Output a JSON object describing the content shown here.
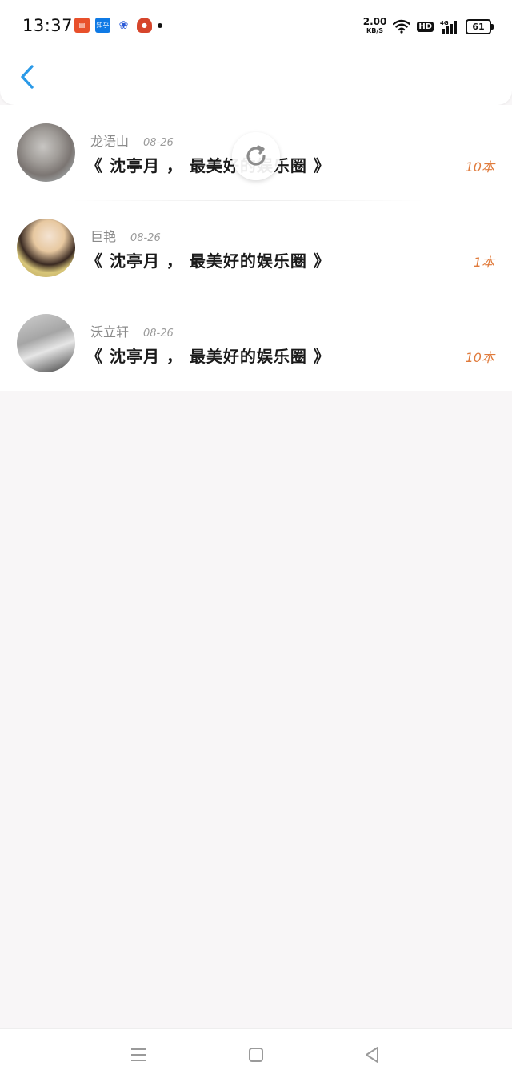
{
  "status_bar": {
    "time": "13:37",
    "net_speed": "2.00",
    "net_unit": "KB/S",
    "hd": "HD",
    "signal": "4G",
    "battery": "61",
    "notification_icons": [
      "ebook-app-icon",
      "zhihu-app-icon",
      "baidu-app-icon",
      "game-app-icon"
    ],
    "notification_labels": {
      "zhihu": "知乎"
    }
  },
  "header": {
    "back_icon": "chevron-left-icon",
    "accent_color": "#2b9ae8"
  },
  "list": [
    {
      "author": "龙语山",
      "date": "08-26",
      "title": "《 沈亭月 ， 最美好的娱乐圈 》",
      "count": "10本"
    },
    {
      "author": "巨艳",
      "date": "08-26",
      "title": "《 沈亭月 ， 最美好的娱乐圈 》",
      "count": "1本"
    },
    {
      "author": "沃立轩",
      "date": "08-26",
      "title": "《 沈亭月 ， 最美好的娱乐圈 》",
      "count": "10本"
    }
  ],
  "colors": {
    "count_color": "#e07b3c",
    "page_background": "#f8f6f7"
  },
  "nav_bar": {
    "icons": [
      "menu-icon",
      "home-icon",
      "back-triangle-icon"
    ]
  }
}
